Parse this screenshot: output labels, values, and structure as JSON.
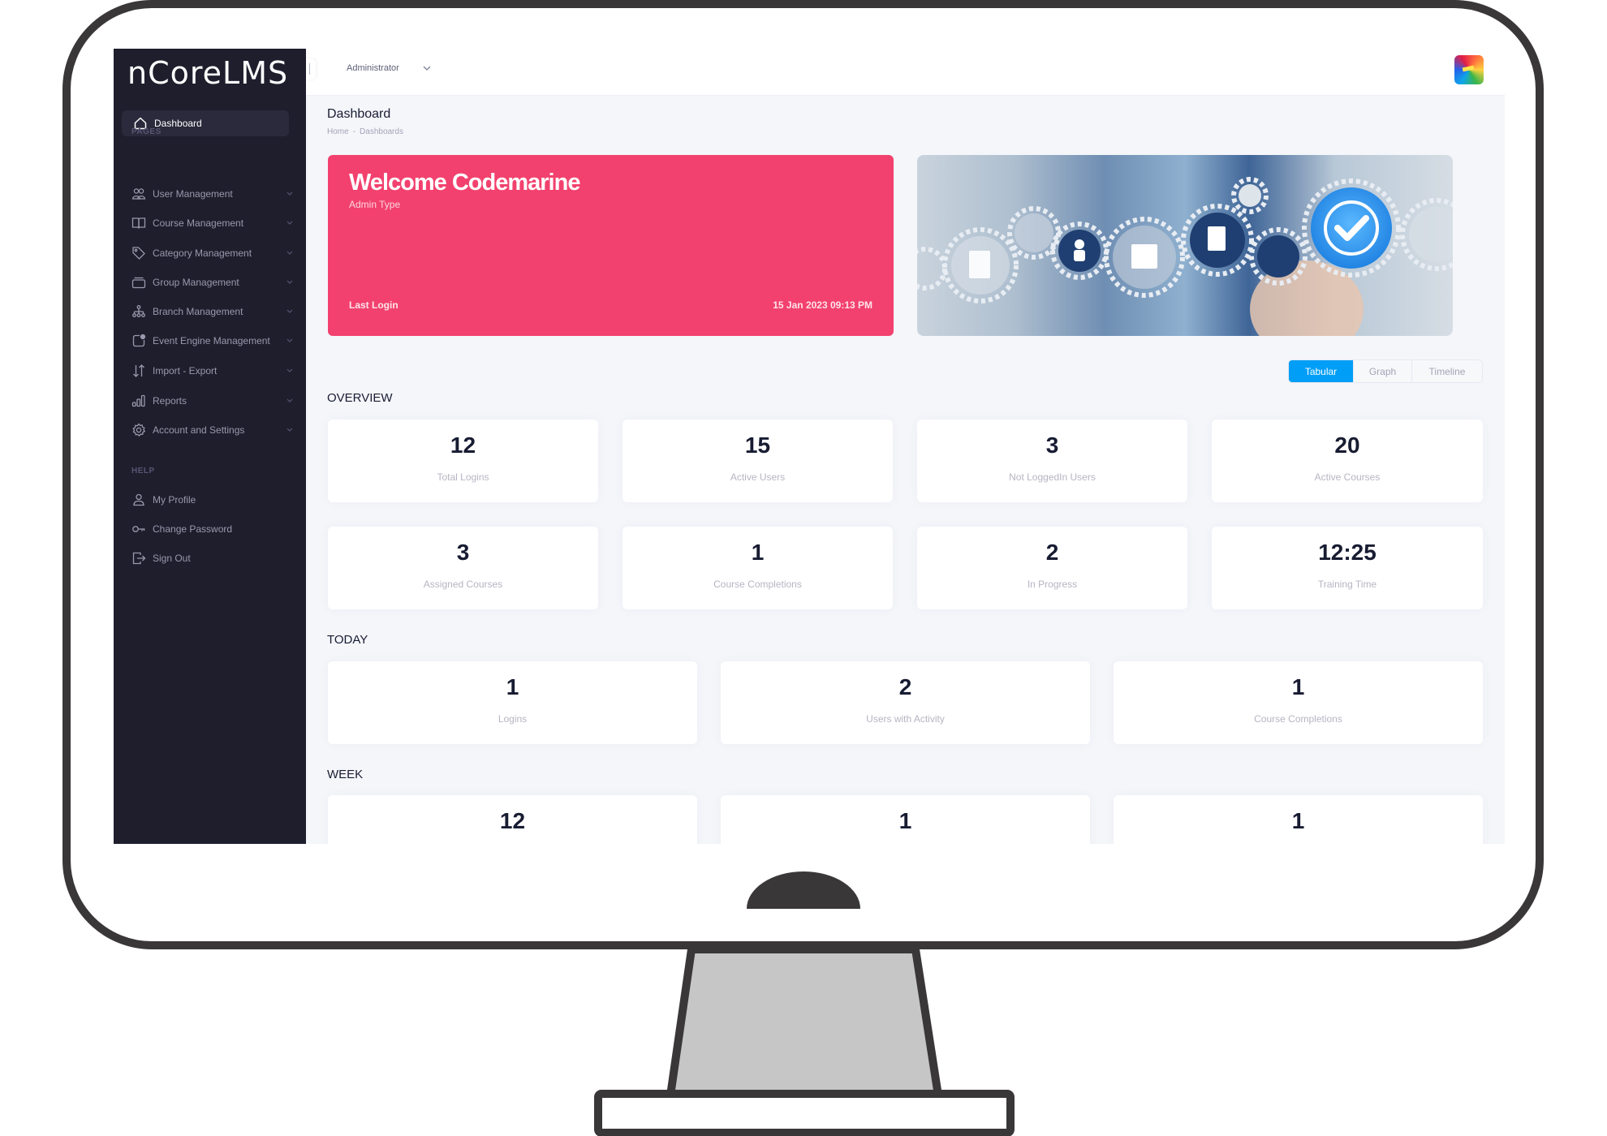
{
  "app": {
    "brand": "nCoreLMS",
    "role_selector": "Administrator"
  },
  "sidebar": {
    "active_item": {
      "label": "Dashboard",
      "icon": "home-icon"
    },
    "pages_label": "PAGES",
    "pages": [
      {
        "label": "User Management",
        "icon": "users-icon"
      },
      {
        "label": "Course Management",
        "icon": "book-icon"
      },
      {
        "label": "Category Management",
        "icon": "tag-icon"
      },
      {
        "label": "Group Management",
        "icon": "layers-icon"
      },
      {
        "label": "Branch Management",
        "icon": "hierarchy-icon"
      },
      {
        "label": "Event Engine Management",
        "icon": "event-icon"
      },
      {
        "label": "Import - Export",
        "icon": "arrows-updown-icon"
      },
      {
        "label": "Reports",
        "icon": "bar-chart-icon"
      },
      {
        "label": "Account and Settings",
        "icon": "gear-icon"
      }
    ],
    "help_label": "HELP",
    "help": [
      {
        "label": "My Profile",
        "icon": "user-icon"
      },
      {
        "label": "Change Password",
        "icon": "key-icon"
      },
      {
        "label": "Sign Out",
        "icon": "sign-out-icon"
      }
    ]
  },
  "page": {
    "title": "Dashboard",
    "breadcrumb": [
      "Home",
      "Dashboards"
    ],
    "breadcrumb_separator": "-"
  },
  "welcome": {
    "title": "Welcome Codemarine",
    "subtitle": "Admin Type",
    "last_login_label": "Last Login",
    "last_login_value": "15 Jan 2023 09:13 PM",
    "color": "#f2416e"
  },
  "view_toggle": {
    "tabs": [
      "Tabular",
      "Graph",
      "Timeline"
    ],
    "active": "Tabular",
    "accent": "#009ef7"
  },
  "overview": {
    "heading": "OVERVIEW",
    "cards": [
      {
        "value": "12",
        "label": "Total Logins"
      },
      {
        "value": "15",
        "label": "Active Users"
      },
      {
        "value": "3",
        "label": "Not LoggedIn Users"
      },
      {
        "value": "20",
        "label": "Active Courses"
      },
      {
        "value": "3",
        "label": "Assigned Courses"
      },
      {
        "value": "1",
        "label": "Course Completions"
      },
      {
        "value": "2",
        "label": "In Progress"
      },
      {
        "value": "12:25",
        "label": "Training Time"
      }
    ]
  },
  "today": {
    "heading": "TODAY",
    "cards": [
      {
        "value": "1",
        "label": "Logins"
      },
      {
        "value": "2",
        "label": "Users with Activity"
      },
      {
        "value": "1",
        "label": "Course Completions"
      }
    ]
  },
  "week": {
    "heading": "WEEK",
    "cards": [
      {
        "value": "12"
      },
      {
        "value": "1"
      },
      {
        "value": "1"
      }
    ]
  }
}
